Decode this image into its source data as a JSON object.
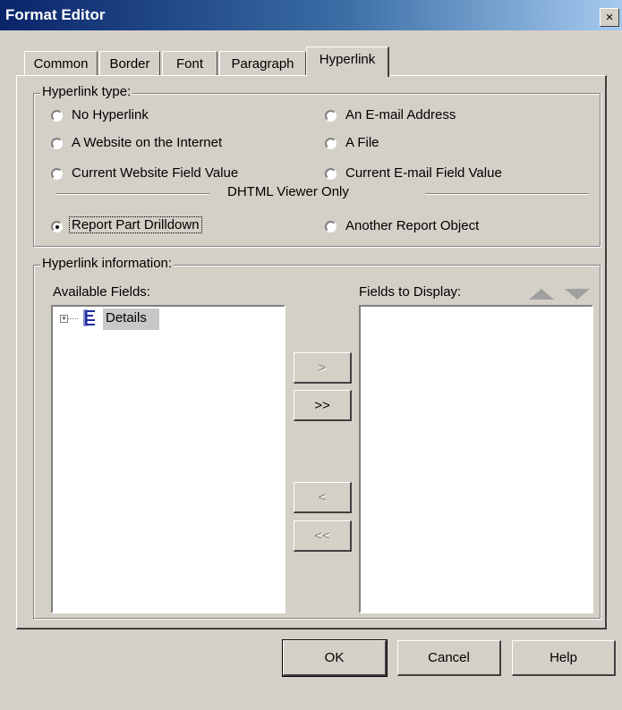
{
  "window": {
    "title": "Format Editor",
    "close_glyph": "×"
  },
  "tabs": [
    {
      "label": "Common",
      "active": false
    },
    {
      "label": "Border",
      "active": false
    },
    {
      "label": "Font",
      "active": false
    },
    {
      "label": "Paragraph",
      "active": false
    },
    {
      "label": "Hyperlink",
      "active": true
    }
  ],
  "hyperlink_type": {
    "group_label": "Hyperlink type:",
    "options": [
      {
        "id": "no-hyperlink",
        "label": "No Hyperlink",
        "selected": false
      },
      {
        "id": "website-internet",
        "label": "A Website on the Internet",
        "selected": false
      },
      {
        "id": "current-website-field",
        "label": "Current Website Field Value",
        "selected": false
      },
      {
        "id": "email-address",
        "label": "An E-mail Address",
        "selected": false
      },
      {
        "id": "a-file",
        "label": "A File",
        "selected": false
      },
      {
        "id": "current-email-field",
        "label": "Current E-mail Field Value",
        "selected": false
      },
      {
        "id": "report-part-drilldown",
        "label": "Report Part Drilldown",
        "selected": true
      },
      {
        "id": "another-report-object",
        "label": "Another Report Object",
        "selected": false
      }
    ],
    "separator_label": "DHTML Viewer Only"
  },
  "hyperlink_info": {
    "group_label": "Hyperlink information:",
    "available_label": "Available Fields:",
    "display_label": "Fields to Display:",
    "tree_item": "Details",
    "expander_glyph": "+",
    "move_one": ">",
    "move_all": ">>",
    "remove_one": "<",
    "remove_all": "<<"
  },
  "buttons": {
    "ok": "OK",
    "cancel": "Cancel",
    "help": "Help"
  },
  "colors": {
    "title_start": "#0a246a",
    "title_end": "#a6caf0",
    "dialog_bg": "#d4d0c8",
    "tree_icon": "#1f2a9e"
  }
}
